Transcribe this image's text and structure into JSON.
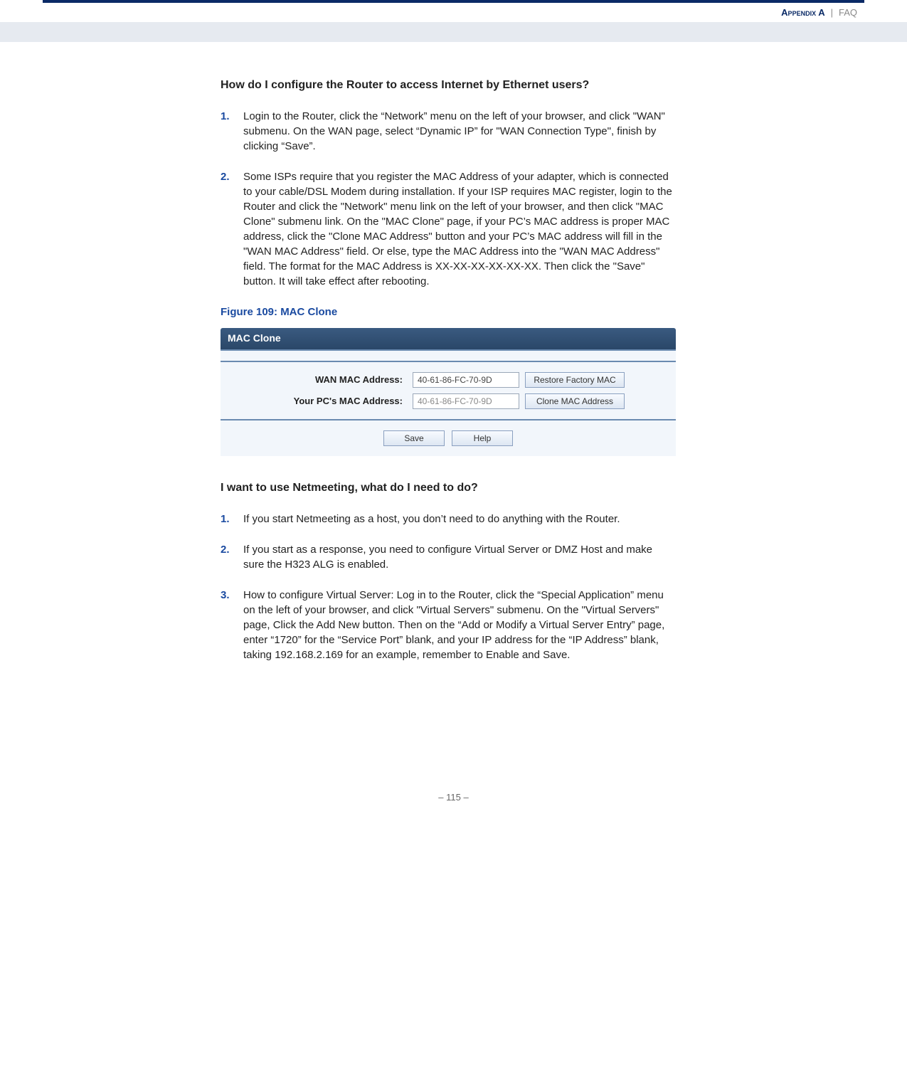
{
  "header": {
    "appendix": "Appendix A",
    "separator": "|",
    "section": "FAQ"
  },
  "q1": {
    "heading": "How do I configure the Router to access Internet by Ethernet users?",
    "items": [
      {
        "num": "1.",
        "text": "Login to the Router, click the “Network” menu on the left of your browser, and click \"WAN\" submenu. On the WAN page, select “Dynamic IP” for \"WAN Connection Type\", finish by clicking “Save”."
      },
      {
        "num": "2.",
        "text": "Some ISPs require that you register the MAC Address of your adapter, which is connected to your cable/DSL Modem during installation. If your ISP requires MAC register, login to the Router and click the \"Network\" menu link on the left of your browser, and then click \"MAC Clone\" submenu link. On the \"MAC Clone\" page, if your PC’s MAC address is proper MAC address, click the \"Clone MAC Address\" button and your PC’s MAC address will fill in the \"WAN MAC Address\" field. Or else, type the MAC Address into the \"WAN MAC Address\" field. The format for the MAC Address is XX-XX-XX-XX-XX-XX. Then click the \"Save\" button. It will take effect after rebooting."
      }
    ]
  },
  "figure": {
    "label": "Figure 109:  MAC Clone",
    "title": "MAC Clone",
    "wan_label": "WAN MAC Address:",
    "wan_value": "40-61-86-FC-70-9D",
    "pc_label": "Your PC's MAC Address:",
    "pc_value": "40-61-86-FC-70-9D",
    "restore_btn": "Restore Factory MAC",
    "clone_btn": "Clone MAC Address",
    "save_btn": "Save",
    "help_btn": "Help"
  },
  "q2": {
    "heading": "I want to use Netmeeting, what do I need to do?",
    "items": [
      {
        "num": "1.",
        "text": "If you start Netmeeting as a host, you don’t need to do anything with the Router."
      },
      {
        "num": "2.",
        "text": "If you start as a response, you need to configure Virtual Server or DMZ Host and make sure the H323 ALG is enabled."
      },
      {
        "num": "3.",
        "text": "How to configure Virtual Server: Log in to the Router, click the “Special Application” menu on the left of your browser, and click \"Virtual Servers\" submenu. On the \"Virtual Servers\" page, Click the Add New button. Then on the “Add or Modify a Virtual Server Entry” page, enter “1720” for the “Service Port” blank, and your IP address for the “IP Address” blank, taking 192.168.2.169 for an example, remember to Enable and Save."
      }
    ]
  },
  "footer": {
    "page": "–  115  –"
  }
}
